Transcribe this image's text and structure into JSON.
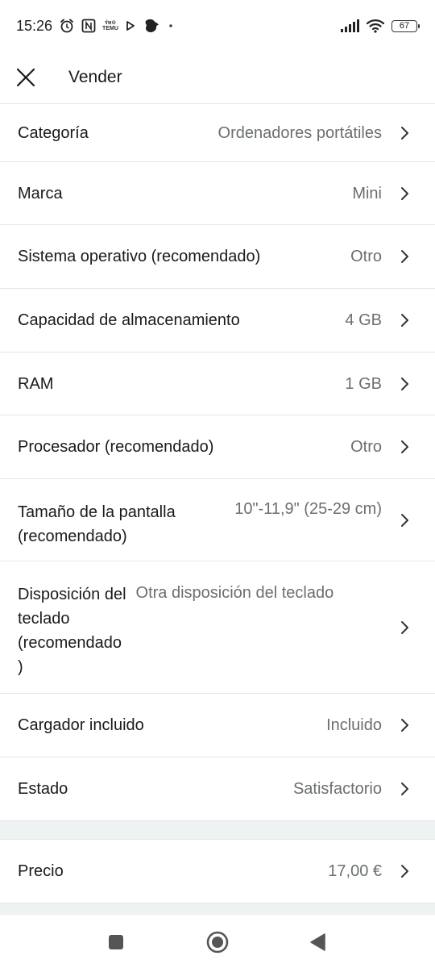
{
  "status_bar": {
    "time": "15:26",
    "battery_level": "67",
    "icons": [
      "alarm-icon",
      "nfc-icon",
      "temu-icon",
      "play-icon",
      "bird-icon",
      "dot-icon",
      "signal-icon",
      "wifi-icon",
      "battery-icon"
    ],
    "temu_line1": "ร่ห⊙",
    "temu_line2": "TEMU"
  },
  "header": {
    "title": "Vender",
    "close_icon": "close-icon"
  },
  "rows": [
    {
      "label": "Categoría",
      "value": "Ordenadores portátiles"
    },
    {
      "label": "Marca",
      "value": "Mini"
    },
    {
      "label": "Sistema operativo (recomendado)",
      "value": "Otro"
    },
    {
      "label": "Capacidad de almacenamiento",
      "value": "4 GB"
    },
    {
      "label": "RAM",
      "value": "1 GB"
    },
    {
      "label": "Procesador (recomendado)",
      "value": "Otro"
    },
    {
      "label_line1": "Tamaño de la pantalla",
      "label_line2": "(recomendado)",
      "value": "10\"-11,9\" (25-29 cm)"
    },
    {
      "label_line1": "Disposición del",
      "label_line2": "teclado",
      "label_line3": "(recomendado",
      "label_line4": ")",
      "value": "Otra disposición del teclado"
    },
    {
      "label": "Cargador incluido",
      "value": "Incluido"
    },
    {
      "label": "Estado",
      "value": "Satisfactorio"
    }
  ],
  "price_row": {
    "label": "Precio",
    "value": "17,00 €"
  },
  "colors": {
    "divider": "#e3e6e6",
    "section_gap": "#eef2f2",
    "value_text": "#6b6f6f",
    "primary_text": "#1a1a1a"
  },
  "nav_bar": {
    "icons": [
      "recents-icon",
      "home-icon",
      "back-icon"
    ]
  }
}
